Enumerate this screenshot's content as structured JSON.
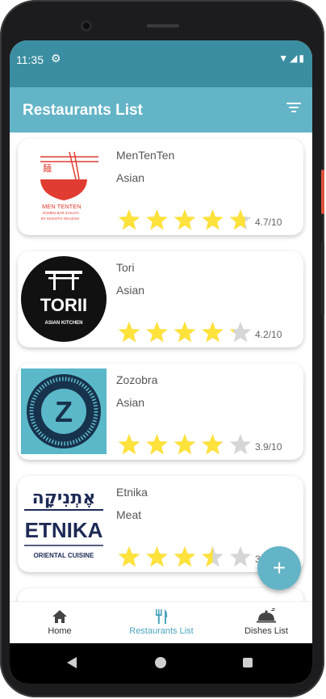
{
  "status": {
    "time": "11:35"
  },
  "app_bar": {
    "title": "Restaurants List"
  },
  "restaurants": [
    {
      "name": "MenTenTen",
      "cuisine": "Asian",
      "rating": "4.7/10",
      "stars": 4.7,
      "logo_text": [
        "麺",
        "MEN TENTEN",
        "RAMEN BAR ZAKAYA",
        "BY MAKOTO OKAZAKI"
      ]
    },
    {
      "name": "Tori",
      "cuisine": "Asian",
      "rating": "4.2/10",
      "stars": 4.2,
      "logo_text": [
        "TORII",
        "ASIAN KITCHEN"
      ]
    },
    {
      "name": "Zozobra",
      "cuisine": "Asian",
      "rating": "3.9/10",
      "stars": 3.9,
      "logo_text": [
        "Z"
      ]
    },
    {
      "name": "Etnika",
      "cuisine": "Meat",
      "rating": "3",
      "stars": 3.5,
      "logo_text": [
        "אֶתְנִיקָה",
        "ETNIKA",
        "ORIENTAL CUISINE"
      ]
    }
  ],
  "fab": {
    "label": "+"
  },
  "bottom_nav": {
    "items": [
      {
        "label": "Home"
      },
      {
        "label": "Restaurants List"
      },
      {
        "label": "Dishes List"
      }
    ],
    "active_color": "#4aa5bd"
  },
  "colors": {
    "status_bar": "#3b8ea1",
    "app_bar": "#64b4c7",
    "star": "#ffe23b",
    "star_empty": "#d6d6d6"
  }
}
